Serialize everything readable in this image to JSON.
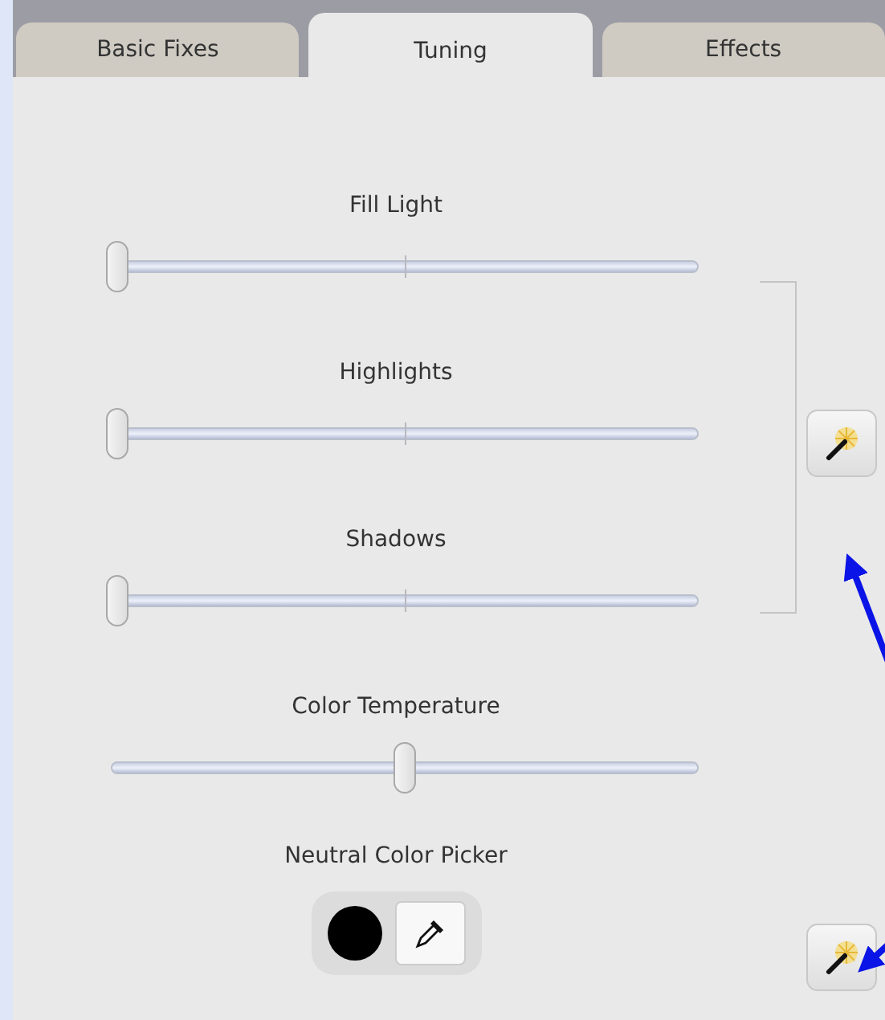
{
  "tabs": [
    {
      "label": "Basic Fixes",
      "selected": false
    },
    {
      "label": "Tuning",
      "selected": true
    },
    {
      "label": "Effects",
      "selected": false
    }
  ],
  "lighting_sliders": [
    {
      "label": "Fill Light",
      "level": 0
    },
    {
      "label": "Highlights",
      "level": 0
    },
    {
      "label": "Shadows",
      "level": 0
    }
  ],
  "color_temperature": {
    "label": "Color Temperature",
    "level": 0.5
  },
  "neutral_color_picker": {
    "label": "Neutral Color Picker"
  }
}
